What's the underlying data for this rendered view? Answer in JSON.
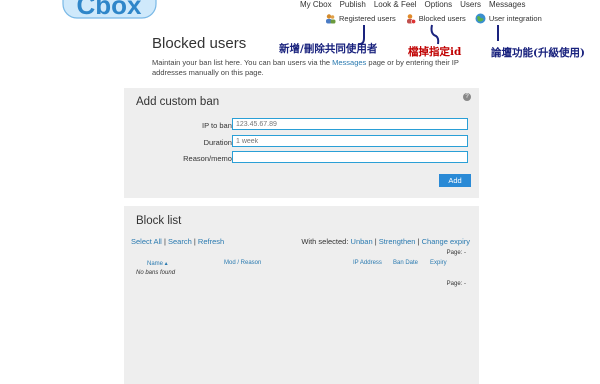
{
  "logo_text": "Cbox",
  "topnav": [
    "My Cbox",
    "Publish",
    "Look & Feel",
    "Options",
    "Users",
    "Messages"
  ],
  "subnav": [
    {
      "label": "Registered users",
      "icon": "users-icon"
    },
    {
      "label": "Blocked users",
      "icon": "blocked-users-icon"
    },
    {
      "label": "User integration",
      "icon": "globe-icon"
    }
  ],
  "annotations": {
    "registered": "新增/刪除共同使用者",
    "blocked": "檔掉指定id",
    "integration": "論壇功能(升級使用)"
  },
  "page": {
    "title": "Blocked users",
    "desc_before": "Maintain your ban list here. You can ban users via the ",
    "desc_link": "Messages",
    "desc_after": " page or by entering their IP addresses manually on this page."
  },
  "custom_ban": {
    "title": "Add custom ban",
    "help": "?",
    "ip_label": "IP to ban:",
    "ip_placeholder": "123.45.67.89",
    "duration_label": "Duration:",
    "duration_placeholder": "1 week",
    "reason_label": "Reason/memo:",
    "reason_placeholder": "",
    "add_label": "Add"
  },
  "block_list": {
    "title": "Block list",
    "select_all": "Select All",
    "search": "Search",
    "refresh": "Refresh",
    "sep": "|",
    "with_selected": "With selected:",
    "unban": "Unban",
    "strengthen": "Strengthen",
    "change_expiry": "Change expiry",
    "page_top": "Page: -",
    "page_bottom": "Page: -",
    "columns": {
      "name": "Name ▴",
      "mod": "Mod / Reason",
      "ip": "IP Address",
      "ban_date": "Ban Date",
      "expiry": "Expiry"
    },
    "empty": "No bans found"
  },
  "colors": {
    "accent": "#2a8ad6",
    "panel": "#eeeeee",
    "annotation": "#1a237e",
    "annotation_red": "#c00000"
  }
}
